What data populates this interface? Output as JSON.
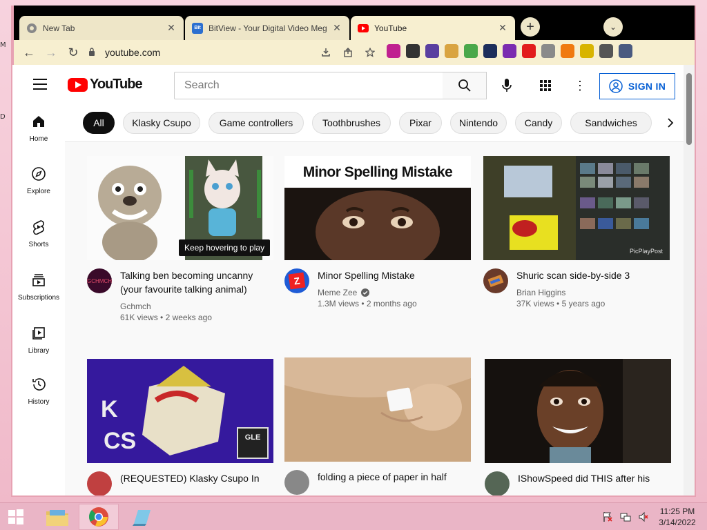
{
  "desktop": {
    "stubs": [
      "M",
      "D"
    ]
  },
  "browser": {
    "tabs": [
      {
        "title": "New Tab",
        "favicon": "chrome-icon",
        "active": false
      },
      {
        "title": "BitView - Your Digital Video Meg",
        "favicon": "bitview-icon",
        "favicon_text": "Bit",
        "active": false
      },
      {
        "title": "YouTube",
        "favicon": "youtube-icon",
        "active": true
      }
    ],
    "new_tab_label": "+",
    "tab_search_label": "⌄",
    "url": "youtube.com",
    "nav": {
      "back": "←",
      "forward": "→",
      "reload": "↻"
    },
    "omnibox_actions": [
      "download-icon",
      "share-icon",
      "star-icon"
    ],
    "extensions": [
      {
        "name": "ext-flag-icon",
        "color": "#c02090"
      },
      {
        "name": "ext-hat-icon",
        "color": "#333333"
      },
      {
        "name": "ext-monster-icon",
        "color": "#5a3fa0"
      },
      {
        "name": "ext-doge-icon",
        "color": "#d9a440"
      },
      {
        "name": "ext-ball-icon",
        "color": "#4aa84a"
      },
      {
        "name": "ext-globe-icon",
        "color": "#1d2e5c"
      },
      {
        "name": "ext-star-icon",
        "color": "#7b2bb0"
      },
      {
        "name": "ext-block-icon",
        "color": "#e21c1c"
      },
      {
        "name": "ext-alien-icon",
        "color": "#8a8a8a"
      },
      {
        "name": "ext-burst-icon",
        "color": "#f07a10"
      },
      {
        "name": "ext-bee-icon",
        "color": "#d8b400"
      },
      {
        "name": "ext-puzzle-icon",
        "color": "#555555"
      },
      {
        "name": "ext-profile-icon",
        "color": "#4a5a80"
      }
    ]
  },
  "youtube": {
    "logo_text": "YouTube",
    "search": {
      "placeholder": "Search",
      "value": ""
    },
    "signin_label": "SIGN IN",
    "guide": [
      {
        "label": "Home",
        "icon": "home-icon"
      },
      {
        "label": "Explore",
        "icon": "compass-icon"
      },
      {
        "label": "Shorts",
        "icon": "shorts-icon"
      },
      {
        "label": "Subscriptions",
        "icon": "subscriptions-icon"
      },
      {
        "label": "Library",
        "icon": "library-icon"
      },
      {
        "label": "History",
        "icon": "history-icon"
      }
    ],
    "chips": [
      "All",
      "Klasky Csupo",
      "Game controllers",
      "Toothbrushes",
      "Pixar",
      "Nintendo",
      "Candy",
      "Sandwiches"
    ],
    "hover_tooltip": "Keep hovering to play",
    "videos": [
      {
        "title": "Talking ben becoming uncanny (your favourite talking animal)",
        "channel": "Gchmch",
        "views": "61K views",
        "age": "2 weeks ago",
        "avatar_text": "GCHMCH",
        "avatar_color": "#3a0a2a",
        "verified": false
      },
      {
        "title": "Minor Spelling Mistake",
        "channel": "Meme Zee",
        "views": "1.3M views",
        "age": "2 months ago",
        "avatar_text": "Z",
        "avatar_color": "#1f5cd6",
        "verified": true,
        "thumb_text": "Minor Spelling Mistake"
      },
      {
        "title": "Shuric scan side-by-side 3",
        "channel": "Brian Higgins",
        "views": "37K views",
        "age": "5 years ago",
        "avatar_text": "",
        "avatar_color": "#6a3a2a",
        "verified": false,
        "thumb_text": "PicPlayPost"
      },
      {
        "title": "(REQUESTED) Klasky Csupo In",
        "channel": "",
        "views": "",
        "age": "",
        "avatar_text": "",
        "avatar_color": "#c04040",
        "verified": false,
        "thumb_text": "GLE"
      },
      {
        "title": "folding a piece of paper in half",
        "channel": "",
        "views": "",
        "age": "",
        "avatar_text": "",
        "avatar_color": "#888888",
        "verified": false
      },
      {
        "title": "IShowSpeed did THIS after his",
        "channel": "",
        "views": "",
        "age": "",
        "avatar_text": "",
        "avatar_color": "#556655",
        "verified": false
      }
    ]
  },
  "taskbar": {
    "time": "11:25 PM",
    "date": "3/14/2022",
    "tray": [
      "flag-icon",
      "network-icon",
      "volume-muted-icon"
    ]
  }
}
